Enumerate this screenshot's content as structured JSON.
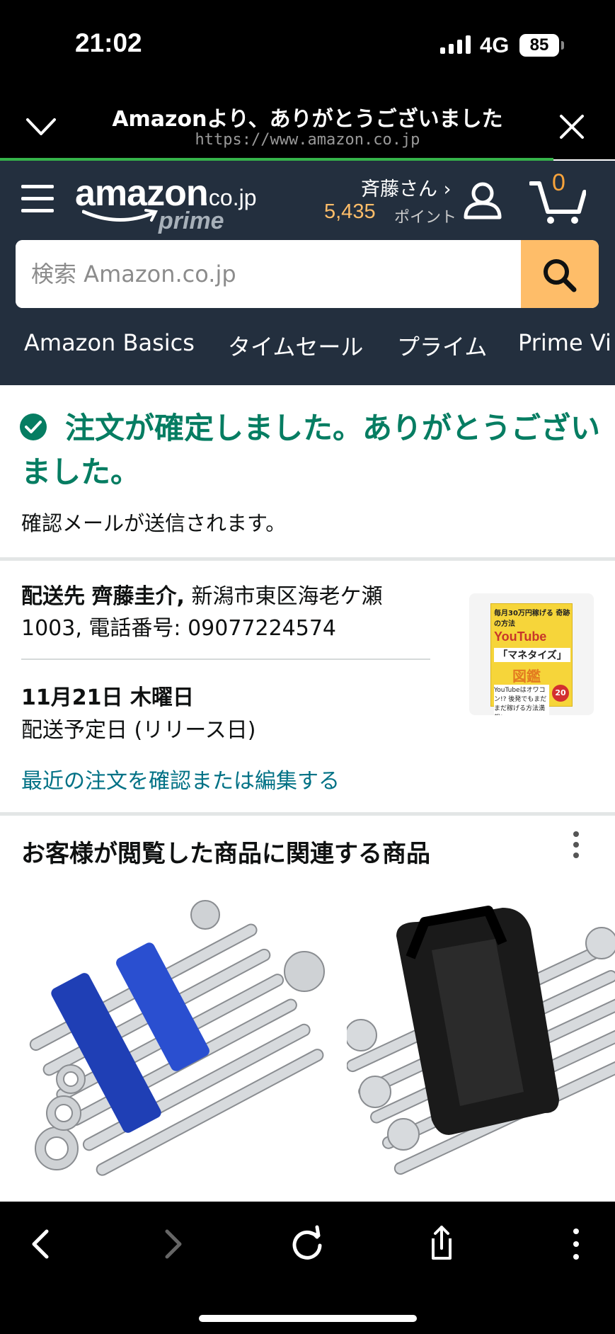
{
  "status_bar": {
    "time": "21:02",
    "network": "4G",
    "battery": "85"
  },
  "browser": {
    "title": "Amazonより、ありがとうございました",
    "url": "https://www.amazon.co.jp"
  },
  "header": {
    "logo_text": "amazon",
    "logo_domain": ".co.jp",
    "logo_prime": "prime",
    "account_name": "斉藤さん ›",
    "points_value": "5,435",
    "points_label": "ポイント",
    "cart_count": "0",
    "search_placeholder": "検索 Amazon.co.jp",
    "nav_links": [
      "Amazon Basics",
      "タイムセール",
      "プライム",
      "Prime Vi"
    ]
  },
  "confirmation": {
    "title": "注文が確定しました。ありがとうございました。",
    "subtitle": "確認メールが送信されます。"
  },
  "delivery": {
    "address_label": "配送先",
    "recipient": "齊藤圭介,",
    "address": "新潟市東区海老ケ瀬1003, 電話番号: 09077224574",
    "date": "11月21日 木曜日",
    "date_note": "配送予定日 (リリース日)",
    "edit_link": "最近の注文を確認または編集する"
  },
  "book_cover": {
    "line1": "毎月30万円稼げる 奇跡の方法",
    "line2": "YouTube",
    "line3": "「マネタイズ」",
    "line4": "図鑑",
    "line5": "YouTubeはオワコン!? 後発でもまだまだ稼げる方法満載!",
    "badge": "20"
  },
  "recommendations": {
    "title": "お客様が閲覧した商品に関連する商品"
  },
  "colors": {
    "header_bg": "#232f3e",
    "accent_orange": "#febd69",
    "success_green": "#067d62",
    "link_teal": "#007185"
  }
}
